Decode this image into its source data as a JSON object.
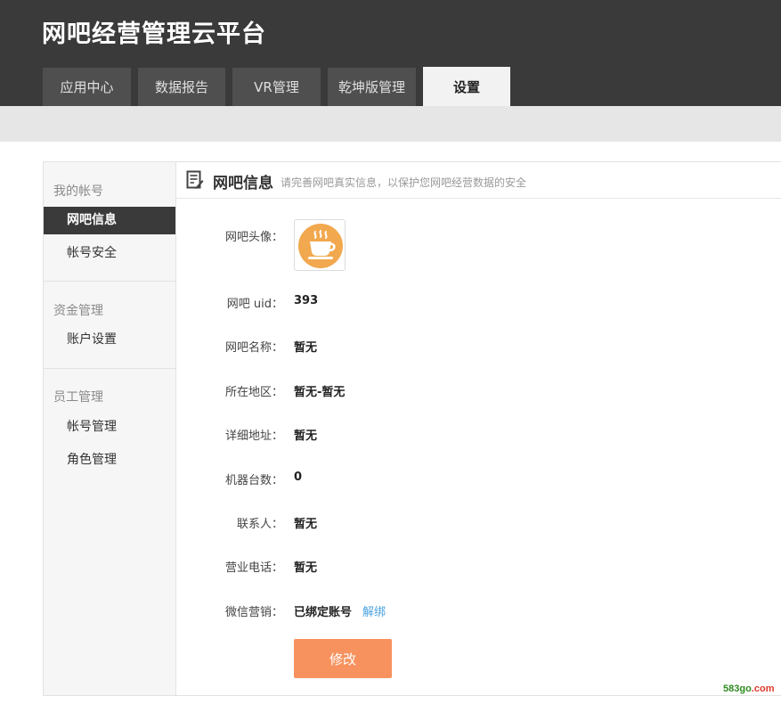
{
  "app": {
    "title": "网吧经营管理云平台"
  },
  "tabs": [
    {
      "label": "应用中心"
    },
    {
      "label": "数据报告"
    },
    {
      "label": "VR管理"
    },
    {
      "label": "乾坤版管理"
    },
    {
      "label": "设置",
      "active": true
    }
  ],
  "sidebar": {
    "groups": [
      {
        "title": "我的帐号",
        "items": [
          {
            "label": "网吧信息",
            "active": true
          },
          {
            "label": "帐号安全"
          }
        ]
      },
      {
        "title": "资金管理",
        "items": [
          {
            "label": "账户设置"
          }
        ]
      },
      {
        "title": "员工管理",
        "items": [
          {
            "label": "帐号管理"
          },
          {
            "label": "角色管理"
          }
        ]
      }
    ]
  },
  "content": {
    "title": "网吧信息",
    "subtitle": "请完善网吧真实信息，以保护您网吧经营数据的安全",
    "header_icon": "document-edit-icon",
    "avatar": {
      "label": "网吧头像：",
      "icon": "coffee-cup-icon",
      "bg_color": "#f2a84e"
    },
    "fields": [
      {
        "label": "网吧 uid：",
        "value": "393"
      },
      {
        "label": "网吧名称：",
        "value": "暂无"
      },
      {
        "label": "所在地区：",
        "value": "暂无-暂无"
      },
      {
        "label": "详细地址：",
        "value": "暂无"
      },
      {
        "label": "机器台数：",
        "value": "0"
      },
      {
        "label": "联系人：",
        "value": "暂无"
      },
      {
        "label": "营业电话：",
        "value": "暂无"
      },
      {
        "label": "微信营销：",
        "value": "已绑定账号",
        "link": "解绑"
      }
    ],
    "modify_button": "修改"
  },
  "watermark": {
    "prefix": "583go",
    "suffix": ".com"
  },
  "colors": {
    "accent_button": "#f7925e",
    "link": "#4aa3df",
    "topbar": "#3a3a3a"
  }
}
